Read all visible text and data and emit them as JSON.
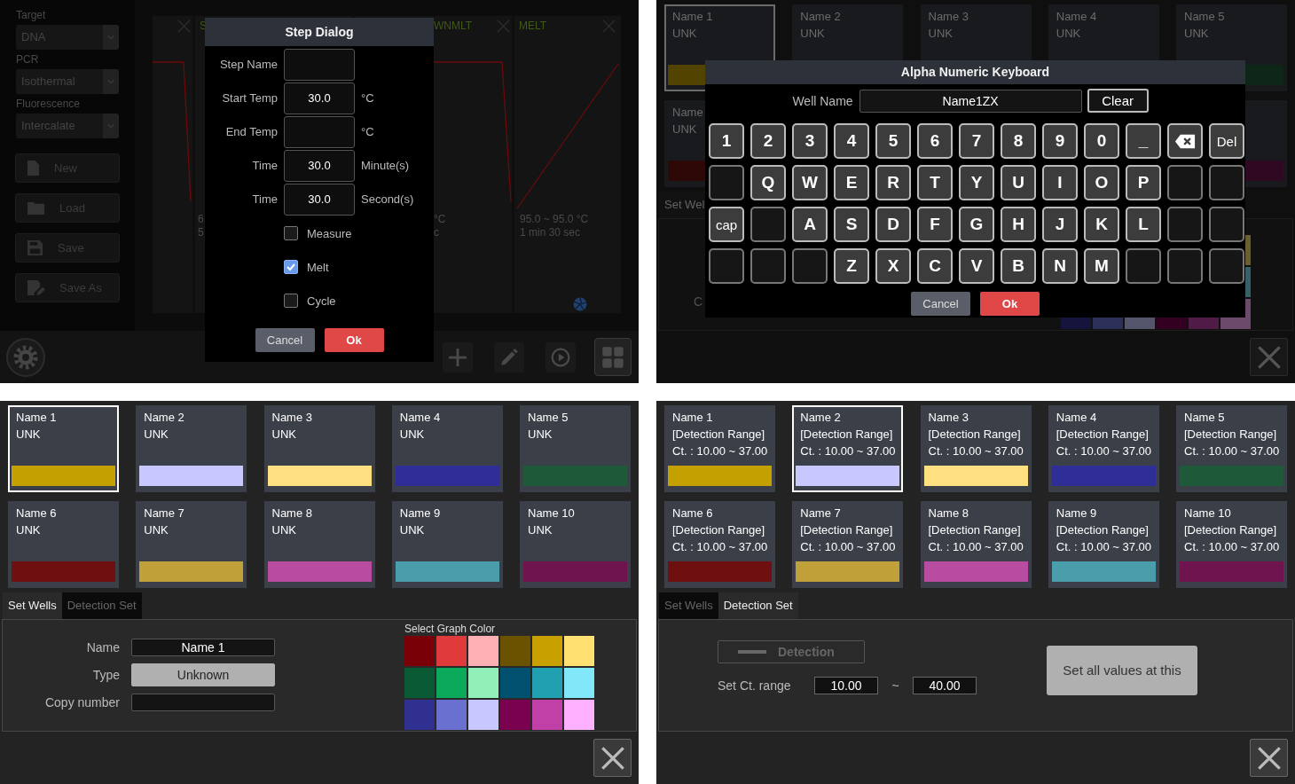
{
  "protocol_editor": {
    "sidebar": {
      "selects": [
        {
          "label": "Target",
          "value": "DNA"
        },
        {
          "label": "PCR",
          "value": "Isothermal"
        },
        {
          "label": "Fluorescence",
          "value": "Intercalate"
        }
      ],
      "buttons": [
        "New",
        "Load",
        "Save",
        "Save As"
      ]
    },
    "steps": [
      {
        "title": "S",
        "info": [
          "6",
          "5"
        ]
      },
      {
        "title": "WNMLT",
        "info": [
          "°C",
          "c"
        ]
      },
      {
        "title": "MELT",
        "info": [
          "95.0 ~ 95.0 °C",
          "1 min 30 sec"
        ]
      }
    ],
    "toolbar": [
      {
        "selected": false
      },
      {
        "selected": false
      },
      {
        "selected": false
      },
      {
        "selected": true
      }
    ],
    "step_dialog": {
      "title": "Step Dialog",
      "fields": [
        {
          "label": "Step Name"
        },
        {
          "label": "Start Temp",
          "value": "30.0",
          "unit": "°C"
        },
        {
          "label": "End Temp",
          "unit": "°C"
        },
        {
          "label": "Time",
          "value": "30.0",
          "unit": "Minute(s)"
        },
        {
          "label": "Time",
          "value": "30.0",
          "unit": "Second(s)"
        }
      ],
      "checkboxes": [
        {
          "label": "Measure",
          "checked": false
        },
        {
          "label": "Melt",
          "checked": true
        },
        {
          "label": "Cycle",
          "checked": false
        }
      ],
      "cancel": "Cancel",
      "ok": "Ok"
    }
  },
  "keyboard_screen": {
    "wells": [
      [
        {
          "lines": [
            "Name 1",
            "UNK"
          ],
          "color": "#524300",
          "selected": true
        },
        {
          "lines": [
            "Name 2",
            "UNK"
          ],
          "selected": false
        },
        {
          "lines": [
            "Name 3",
            "UNK"
          ],
          "selected": false
        },
        {
          "lines": [
            "Name 4",
            "UNK"
          ],
          "selected": false
        },
        {
          "lines": [
            "Name 5",
            "UNK"
          ],
          "color": "#0d2618",
          "selected": false
        }
      ],
      [
        {
          "lines": [
            "Name",
            "UNK"
          ],
          "color": "#2e0707",
          "selected": false
        },
        {
          "color": "#2f0822",
          "selected": false
        }
      ]
    ],
    "tabs": [
      {
        "label": "Set Wel",
        "selected": true
      }
    ],
    "form_label": "C",
    "palette": {
      "rows": [
        [
          {
            "color": "#6b5e2f"
          }
        ],
        [
          {
            "color": "#366168"
          }
        ],
        [
          {
            "color": "#14143c"
          },
          {
            "color": "#2c2f57"
          },
          {
            "color": "#54546b"
          },
          {
            "color": "#330022"
          },
          {
            "color": "#501b46"
          },
          {
            "color": "#6b4a6b"
          }
        ]
      ]
    },
    "keyboard": {
      "title": "Alpha Numeric Keyboard",
      "field_label": "Well Name",
      "value": "Name1ZX",
      "clear": "Clear",
      "rows": [
        [
          {
            "kind": "char",
            "label": "1"
          },
          {
            "kind": "char",
            "label": "2"
          },
          {
            "kind": "char",
            "label": "3"
          },
          {
            "kind": "char",
            "label": "4"
          },
          {
            "kind": "char",
            "label": "5"
          },
          {
            "kind": "char",
            "label": "6"
          },
          {
            "kind": "char",
            "label": "7"
          },
          {
            "kind": "char",
            "label": "8"
          },
          {
            "kind": "char",
            "label": "9"
          },
          {
            "kind": "char",
            "label": "0"
          },
          {
            "kind": "char",
            "label": "_"
          },
          {
            "kind": "backspace"
          },
          {
            "kind": "word",
            "label": "Del"
          }
        ],
        [
          {
            "kind": "blank"
          },
          {
            "kind": "char",
            "label": "Q"
          },
          {
            "kind": "char",
            "label": "W"
          },
          {
            "kind": "char",
            "label": "E"
          },
          {
            "kind": "char",
            "label": "R"
          },
          {
            "kind": "char",
            "label": "T"
          },
          {
            "kind": "char",
            "label": "Y"
          },
          {
            "kind": "char",
            "label": "U"
          },
          {
            "kind": "char",
            "label": "I"
          },
          {
            "kind": "char",
            "label": "O"
          },
          {
            "kind": "char",
            "label": "P"
          },
          {
            "kind": "blank"
          },
          {
            "kind": "blank"
          }
        ],
        [
          {
            "kind": "word",
            "label": "cap"
          },
          {
            "kind": "blank"
          },
          {
            "kind": "char",
            "label": "A"
          },
          {
            "kind": "char",
            "label": "S"
          },
          {
            "kind": "char",
            "label": "D"
          },
          {
            "kind": "char",
            "label": "F"
          },
          {
            "kind": "char",
            "label": "G"
          },
          {
            "kind": "char",
            "label": "H"
          },
          {
            "kind": "char",
            "label": "J"
          },
          {
            "kind": "char",
            "label": "K"
          },
          {
            "kind": "char",
            "label": "L"
          },
          {
            "kind": "blank"
          },
          {
            "kind": "blank"
          }
        ],
        [
          {
            "kind": "blank"
          },
          {
            "kind": "blank"
          },
          {
            "kind": "blank"
          },
          {
            "kind": "char",
            "label": "Z"
          },
          {
            "kind": "char",
            "label": "X"
          },
          {
            "kind": "char",
            "label": "C"
          },
          {
            "kind": "char",
            "label": "V"
          },
          {
            "kind": "char",
            "label": "B"
          },
          {
            "kind": "char",
            "label": "N"
          },
          {
            "kind": "char",
            "label": "M"
          },
          {
            "kind": "blank"
          },
          {
            "kind": "blank"
          },
          {
            "kind": "blank"
          }
        ]
      ],
      "cancel": "Cancel",
      "ok": "Ok"
    }
  },
  "set_wells_screen": {
    "wells": [
      [
        {
          "lines": [
            "Name 1",
            "UNK"
          ],
          "color": "#c4a000",
          "selected": true
        },
        {
          "lines": [
            "Name 2",
            "UNK"
          ],
          "color": "#c8c8ff",
          "selected": false
        },
        {
          "lines": [
            "Name 3",
            "UNK"
          ],
          "color": "#ffe080",
          "selected": false
        },
        {
          "lines": [
            "Name 4",
            "UNK"
          ],
          "color": "#2e2e96",
          "selected": false
        },
        {
          "lines": [
            "Name 5",
            "UNK"
          ],
          "color": "#1e5a3a",
          "selected": false
        }
      ],
      [
        {
          "lines": [
            "Name 6",
            "UNK"
          ],
          "color": "#6e1010",
          "selected": false
        },
        {
          "lines": [
            "Name 7",
            "UNK"
          ],
          "color": "#c0a038",
          "selected": false
        },
        {
          "lines": [
            "Name 8",
            "UNK"
          ],
          "color": "#b84ca0",
          "selected": false
        },
        {
          "lines": [
            "Name 9",
            "UNK"
          ],
          "color": "#4a9eac",
          "selected": false
        },
        {
          "lines": [
            "Name 10",
            "UNK"
          ],
          "color": "#701450",
          "selected": false
        }
      ]
    ],
    "tabs": [
      {
        "label": "Set Wells",
        "selected": true
      },
      {
        "label": "Detection Set",
        "selected": false
      }
    ],
    "form": [
      {
        "kind": "text",
        "label": "Name",
        "value": "Name 1"
      },
      {
        "kind": "select",
        "label": "Type",
        "value": "Unknown"
      },
      {
        "kind": "text",
        "label": "Copy number"
      }
    ],
    "palette": {
      "title": "Select Graph Color",
      "rows": [
        [
          {
            "color": "#7a0008"
          },
          {
            "color": "#e03a3a"
          },
          {
            "color": "#ffb0b4"
          },
          {
            "color": "#6a5200"
          },
          {
            "color": "#c8a000"
          },
          {
            "color": "#ffe070"
          }
        ],
        [
          {
            "color": "#0a5a35"
          },
          {
            "color": "#0aaa5a"
          },
          {
            "color": "#90f0b8"
          },
          {
            "color": "#005070"
          },
          {
            "color": "#20a0b0"
          },
          {
            "color": "#80e8f8"
          }
        ],
        [
          {
            "color": "#303090"
          },
          {
            "color": "#6a70d0"
          },
          {
            "color": "#c8c8ff"
          },
          {
            "color": "#7a0050"
          },
          {
            "color": "#c040a8"
          },
          {
            "color": "#ffb0ff"
          }
        ]
      ]
    }
  },
  "detection_set_screen": {
    "wells": [
      [
        {
          "lines": [
            "Name 1",
            "[Detection Range]",
            "Ct. : 10.00 ~ 37.00"
          ],
          "color": "#c4a000",
          "selected": false
        },
        {
          "lines": [
            "Name 2",
            "[Detection Range]",
            "Ct. : 10.00 ~ 37.00"
          ],
          "color": "#c8c8ff",
          "selected": true
        },
        {
          "lines": [
            "Name 3",
            "[Detection Range]",
            "Ct. : 10.00 ~ 37.00"
          ],
          "color": "#ffe080",
          "selected": false
        },
        {
          "lines": [
            "Name 4",
            "[Detection Range]",
            "Ct. : 10.00 ~ 37.00"
          ],
          "color": "#2e2e96",
          "selected": false
        },
        {
          "lines": [
            "Name 5",
            "[Detection Range]",
            "Ct. : 10.00 ~ 37.00"
          ],
          "color": "#1e5a3a",
          "selected": false
        }
      ],
      [
        {
          "lines": [
            "Name 6",
            "[Detection Range]",
            "Ct. : 10.00 ~ 37.00"
          ],
          "color": "#6e1010",
          "selected": false
        },
        {
          "lines": [
            "Name 7",
            "[Detection Range]",
            "Ct. : 10.00 ~ 37.00"
          ],
          "color": "#c0a038",
          "selected": false
        },
        {
          "lines": [
            "Name 8",
            "[Detection Range]",
            "Ct. : 10.00 ~ 37.00"
          ],
          "color": "#b84ca0",
          "selected": false
        },
        {
          "lines": [
            "Name 9",
            "[Detection Range]",
            "Ct. : 10.00 ~ 37.00"
          ],
          "color": "#4a9eac",
          "selected": false
        },
        {
          "lines": [
            "Name 10",
            "[Detection Range]",
            "Ct. : 10.00 ~ 37.00"
          ],
          "color": "#701450",
          "selected": false
        }
      ]
    ],
    "tabs": [
      {
        "label": "Set Wells",
        "selected": false
      },
      {
        "label": "Detection Set",
        "selected": true
      }
    ],
    "detection_toggle": {
      "label": "Detection",
      "on": false
    },
    "ct_range": {
      "label": "Set Ct. range",
      "min": "10.00",
      "separator": "~",
      "max": "40.00"
    },
    "apply_button": "Set all values at this"
  }
}
